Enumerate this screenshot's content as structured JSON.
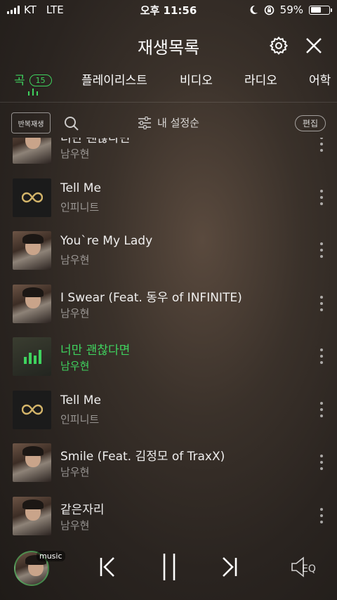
{
  "status_bar": {
    "carrier": "KT",
    "network": "LTE",
    "time": "오후 11:56",
    "battery_percent": "59%",
    "battery_level": 0.59
  },
  "header": {
    "title": "재생목록"
  },
  "tabs": [
    {
      "label": "곡",
      "badge": "15",
      "active": true
    },
    {
      "label": "플레이리스트"
    },
    {
      "label": "비디오"
    },
    {
      "label": "라디오"
    },
    {
      "label": "어학"
    }
  ],
  "toolbar": {
    "repeat_label": "반복재생",
    "sort_label": "내 설정순",
    "edit_label": "편집"
  },
  "songs": [
    {
      "title": "너만 괜찮다면",
      "artist": "남우현",
      "thumb": "person"
    },
    {
      "title": "Tell Me",
      "artist": "인피니트",
      "thumb": "infinite"
    },
    {
      "title": "You`re My Lady",
      "artist": "남우현",
      "thumb": "person"
    },
    {
      "title": "I Swear (Feat. 동우 of INFINITE)",
      "artist": "남우현",
      "thumb": "person"
    },
    {
      "title": "너만 괜찮다면",
      "artist": "남우현",
      "thumb": "playing",
      "playing": true
    },
    {
      "title": "Tell Me",
      "artist": "인피니트",
      "thumb": "infinite"
    },
    {
      "title": "Smile (Feat. 김정모 of TraxX)",
      "artist": "남우현",
      "thumb": "person"
    },
    {
      "title": "같은자리",
      "artist": "남우현",
      "thumb": "person"
    }
  ],
  "player": {
    "badge": "music",
    "eq_label": "EQ"
  },
  "colors": {
    "accent": "#3fd25e",
    "infinite_logo": "#d4b56a"
  }
}
